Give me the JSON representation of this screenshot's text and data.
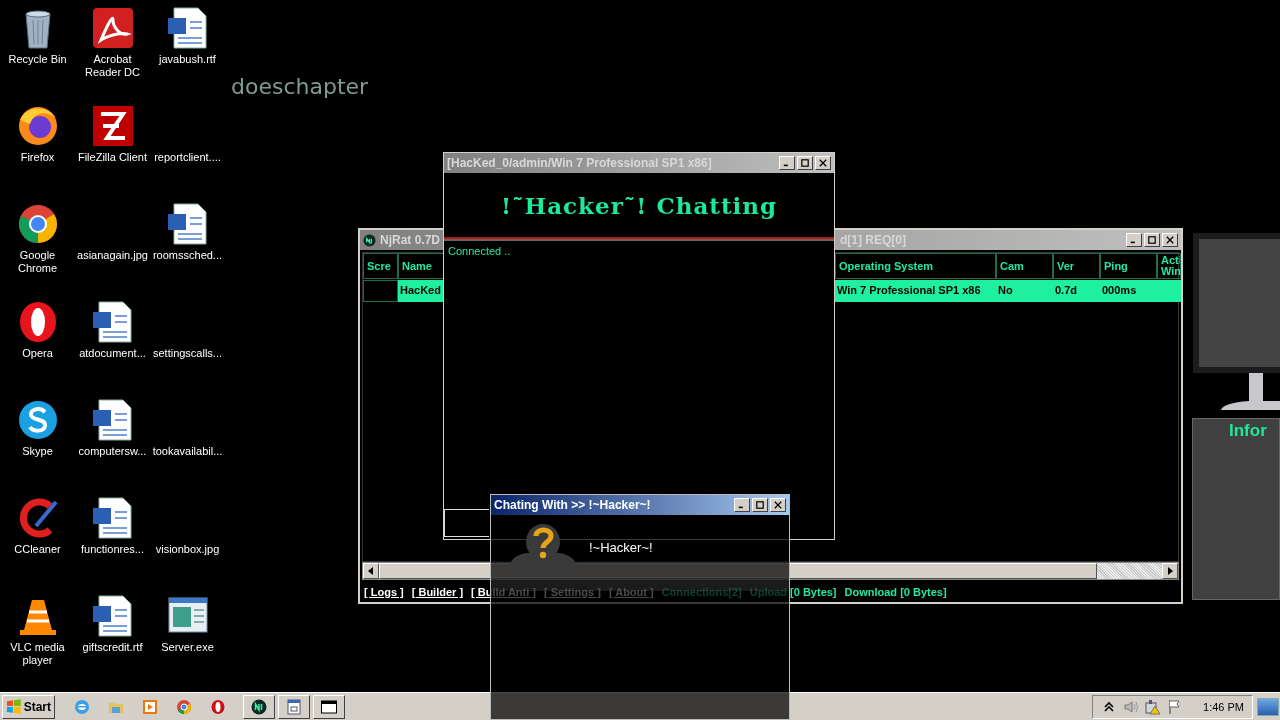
{
  "desktop": {
    "wallpaper_text": "doeschapter",
    "icons": [
      {
        "label": "Recycle Bin",
        "kind": "recycle"
      },
      {
        "label": "Acrobat Reader DC",
        "kind": "pdf"
      },
      {
        "label": "javabush.rtf",
        "kind": "word"
      },
      {
        "label": "Firefox",
        "kind": "firefox"
      },
      {
        "label": "FileZilla Client",
        "kind": "filezilla"
      },
      {
        "label": "reportclient....",
        "kind": "blank"
      },
      {
        "label": "Google Chrome",
        "kind": "chrome"
      },
      {
        "label": "asianagain.jpg",
        "kind": "blank"
      },
      {
        "label": "roomssched...",
        "kind": "word"
      },
      {
        "label": "Opera",
        "kind": "opera"
      },
      {
        "label": "atdocument...",
        "kind": "word"
      },
      {
        "label": "settingscalls...",
        "kind": "blank"
      },
      {
        "label": "Skype",
        "kind": "skype"
      },
      {
        "label": "computersw...",
        "kind": "word"
      },
      {
        "label": "tookavailabil...",
        "kind": "blank"
      },
      {
        "label": "CCleaner",
        "kind": "ccleaner"
      },
      {
        "label": "functionres...",
        "kind": "word"
      },
      {
        "label": "visionbox.jpg",
        "kind": "blank"
      },
      {
        "label": "VLC media player",
        "kind": "vlc"
      },
      {
        "label": "giftscredit.rtf",
        "kind": "word"
      },
      {
        "label": "Server.exe",
        "kind": "exe"
      }
    ]
  },
  "njrat_window": {
    "title": "NjRat 0.7D",
    "title_tail": "d[1] REQ[0]",
    "active": false,
    "columns": [
      "Scre",
      "Name",
      "Operating System",
      "Cam",
      "Ver",
      "Ping",
      "Acti Win"
    ],
    "rows": [
      {
        "selected": true,
        "cells": [
          null,
          "HacKed",
          "Win 7 Professional SP1 x86",
          "No",
          "0.7d",
          "000ms",
          null
        ]
      }
    ],
    "status": [
      {
        "kind": "link",
        "text": "[ Logs ]"
      },
      {
        "kind": "link",
        "text": "[ Builder ]"
      },
      {
        "kind": "link",
        "text": "[ Build Anti ]"
      },
      {
        "kind": "link",
        "text": "[ Settings ]"
      },
      {
        "kind": "link",
        "text": "[ About ]"
      },
      {
        "kind": "count",
        "text": "Connections[2]"
      },
      {
        "kind": "count",
        "text": "Upload [0 Bytes]"
      },
      {
        "kind": "count",
        "text": "Download [0 Bytes]"
      }
    ]
  },
  "hacker_chat_window": {
    "title": "[HacKed_0/admin/Win 7 Professional SP1 x86]",
    "active": false,
    "banner": "!˜Hacker˜! Chatting",
    "log": [
      "Connected .."
    ]
  },
  "chat_with_window": {
    "title": "Chating With >> !~Hacker~!",
    "active": true,
    "contact": "!~Hacker~!"
  },
  "info_panel": {
    "heading": "Infor"
  },
  "taskbar": {
    "start": "Start",
    "clock": "1:46 PM"
  }
}
